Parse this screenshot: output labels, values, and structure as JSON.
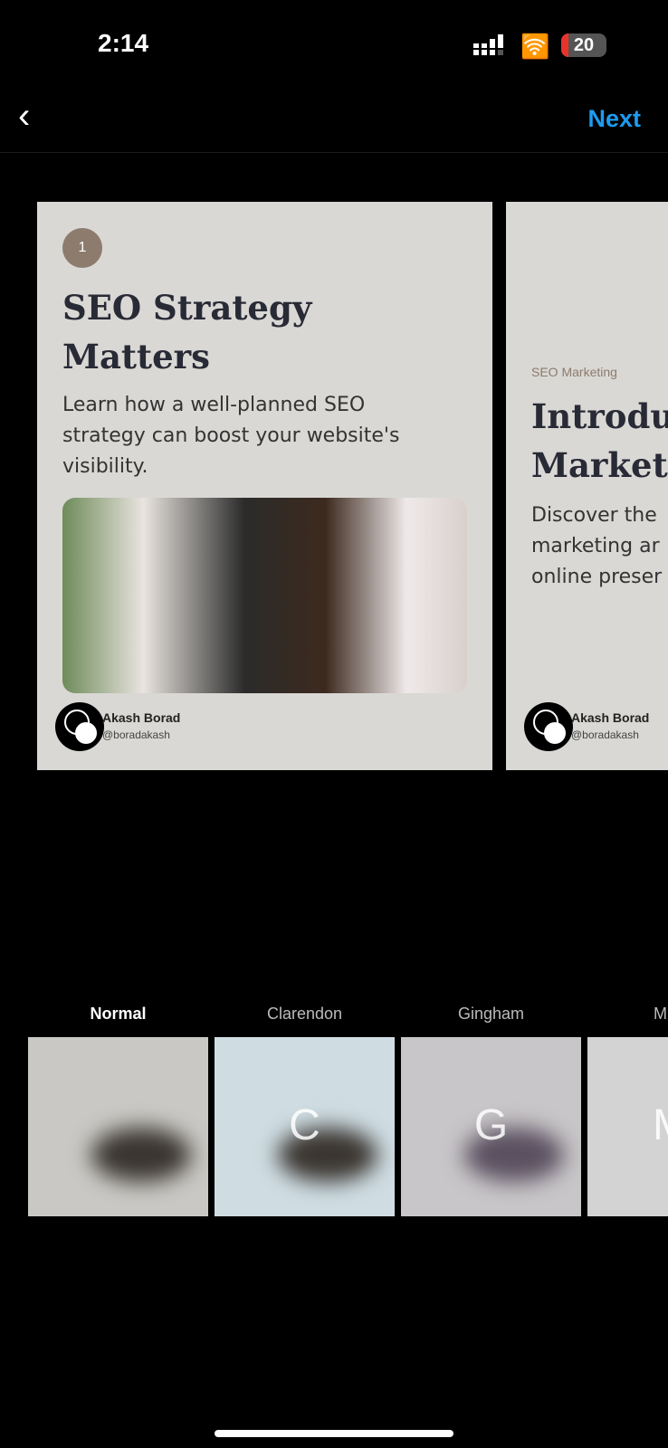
{
  "status": {
    "time": "2:14",
    "battery": "20"
  },
  "nav": {
    "back_icon": "chevron-left-icon",
    "next_label": "Next"
  },
  "slides": [
    {
      "number": "1",
      "title_line1": "SEO Strategy",
      "title_line2": "Matters",
      "desc_line1": "Learn how a well-planned SEO",
      "desc_line2": "strategy can boost your website's",
      "desc_line3": "visibility.",
      "author": "Akash Borad",
      "handle": "@boradakash"
    },
    {
      "eyebrow": "SEO Marketing",
      "title_line1": "Introdu",
      "title_line2": "Market",
      "desc_line1": "Discover the",
      "desc_line2": "marketing ar",
      "desc_line3": "online preser",
      "author": "Akash Borad",
      "handle": "@boradakash"
    }
  ],
  "filters": [
    {
      "label": "Normal",
      "letter": ""
    },
    {
      "label": "Clarendon",
      "letter": "C"
    },
    {
      "label": "Gingham",
      "letter": "G"
    },
    {
      "label": "M",
      "letter": "M"
    }
  ],
  "colors": {
    "accent": "#1d9bf0",
    "card_bg": "#d9d8d4",
    "badge": "#8d7b6d"
  }
}
